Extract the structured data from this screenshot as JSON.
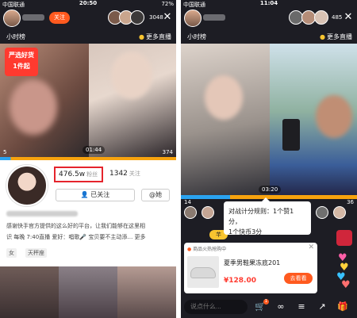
{
  "left": {
    "status": {
      "carrier": "中国联通",
      "time": "20:50",
      "battery": "72%"
    },
    "topbar": {
      "follow": "关注",
      "viewer_count": "3048"
    },
    "subbar": {
      "rank": "小时榜",
      "more_live": "更多直播"
    },
    "video": {
      "duration": "01:44",
      "left_banner": "严选好货\n1件起",
      "pk_left_score": "5",
      "pk_right_score": "374"
    },
    "profile": {
      "fans_count": "476.5w",
      "fans_label": "粉丝",
      "following_count": "1342",
      "following_label": "关注",
      "followed_button": "已关注",
      "she_button": "@她",
      "bio_line1": "感谢快手官方提供的这么好的平台，让我们能够在这里相",
      "bio_line2": "识 每晚 7:40直播  爱好：唱歌🎤 宝贝要不主动添… 更多",
      "gender_tag": "女",
      "zodiac_tag": "天秤座"
    }
  },
  "right": {
    "status": {
      "carrier": "中国联通",
      "time": "11:04",
      "battery": ""
    },
    "topbar": {
      "viewer_count": "485"
    },
    "subbar": {
      "rank": "小时榜",
      "more_live": "更多直播"
    },
    "video": {
      "duration": "03:20",
      "pk_left_score": "14",
      "pk_right_score": "36"
    },
    "score_popup": {
      "line1": "对战计分规则：1个赞1分，",
      "line2": "1个快币3分"
    },
    "pk_label": "芊",
    "product": {
      "header": "商品火热抢购中",
      "title": "夏季男鞋果冻底201",
      "price": "¥128.00",
      "buy_button": "去看看"
    },
    "bottombar": {
      "say_placeholder": "说点什么...",
      "cart_count": "1"
    }
  },
  "colors": {
    "accent": "#ff5a1f",
    "fans_box": "#e5242c",
    "pk_blue": "#2aa3f0",
    "pk_orange": "#f7a30e",
    "price": "#ff3b30"
  }
}
